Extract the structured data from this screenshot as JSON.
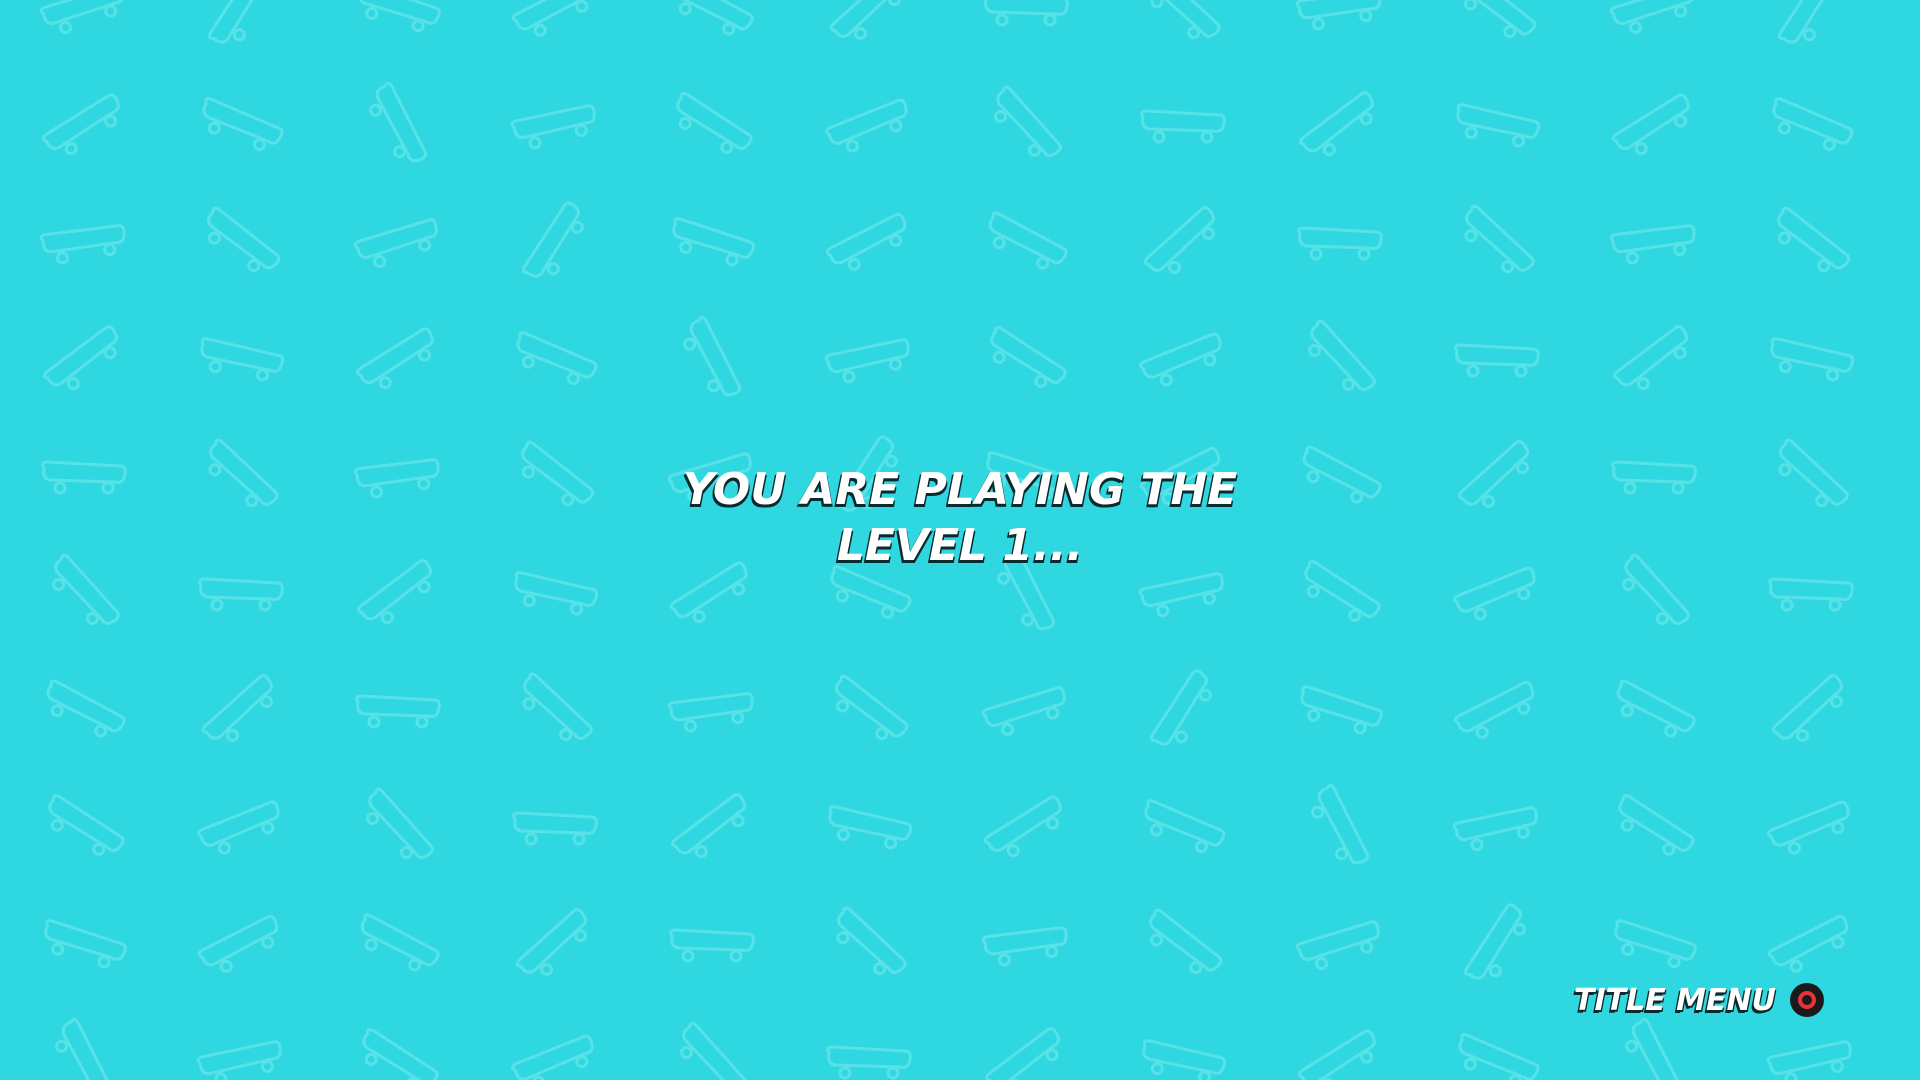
{
  "screen": {
    "background_color": "#2fd8e0",
    "pattern_icon": "skateboard-icon",
    "pattern_color": "#58e2e8"
  },
  "message": {
    "line1": "YOU ARE PLAYING THE",
    "line2": "LEVEL 1..."
  },
  "title_menu": {
    "label": "TITLE MENU",
    "button_icon": "circle-button-icon",
    "button_color": "#e8323c"
  }
}
